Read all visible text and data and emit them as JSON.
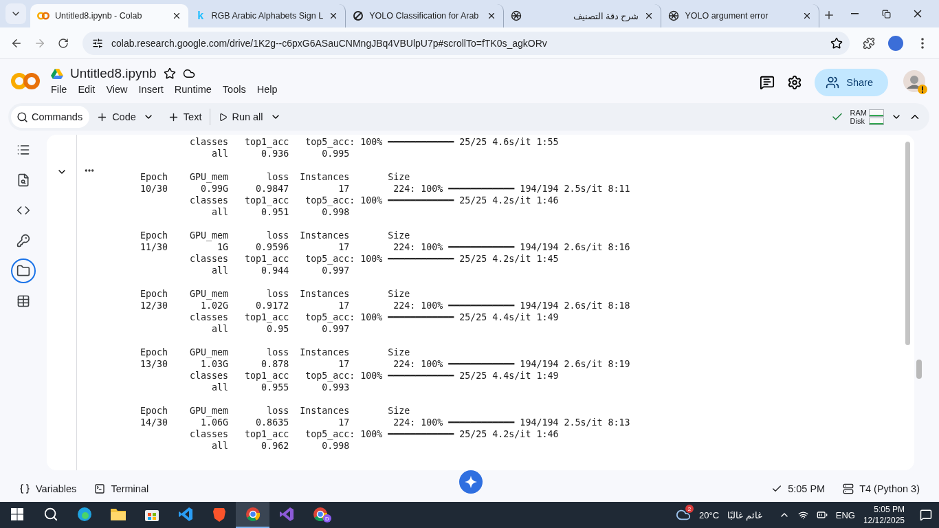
{
  "browser": {
    "tabs": [
      {
        "title": "Untitled8.ipynb - Colab",
        "kind": "colab",
        "selected": true
      },
      {
        "title": "RGB Arabic Alphabets Sign L",
        "kind": "glyph",
        "glyph": "k",
        "selected": false
      },
      {
        "title": "YOLO Classification for Arab",
        "kind": "ring",
        "selected": false
      },
      {
        "title": "شرح دقة التصنيف",
        "kind": "knot",
        "selected": false
      },
      {
        "title": "YOLO argument error",
        "kind": "knot",
        "selected": false
      }
    ],
    "url": "colab.research.google.com/drive/1K2g--c6pxG6ASauCNMngJBq4VBUlpU7p#scrollTo=fTK0s_agkORv"
  },
  "notebook": {
    "title": "Untitled8.ipynb",
    "menu": [
      "File",
      "Edit",
      "View",
      "Insert",
      "Runtime",
      "Tools",
      "Help"
    ],
    "share": "Share"
  },
  "toolbar": {
    "commands": "Commands",
    "code": "Code",
    "text": "Text",
    "run_all": "Run all",
    "connected": true,
    "ram": "RAM",
    "disk": "Disk"
  },
  "sidebar": [
    {
      "kind": "toc",
      "selected": false
    },
    {
      "kind": "find",
      "selected": false
    },
    {
      "kind": "code",
      "selected": false
    },
    {
      "kind": "key",
      "selected": false
    },
    {
      "kind": "files",
      "selected": true
    },
    {
      "kind": "table",
      "selected": false
    }
  ],
  "cell": {
    "expanded": true,
    "lines": [
      {
        "kind": "text",
        "text": "         classes   top1_acc   top5_acc: 100% ━━━━━━━━━━━━ 25/25 4.6s/it 1:55"
      },
      {
        "kind": "text",
        "text": "             all      0.936      0.995"
      },
      {
        "kind": "blank"
      },
      {
        "kind": "text",
        "text": "Epoch    GPU_mem       loss  Instances       Size"
      },
      {
        "kind": "text",
        "text": "10/30      0.99G     0.9847         17        224: 100% ━━━━━━━━━━━━ 194/194 2.5s/it 8:11"
      },
      {
        "kind": "text",
        "text": "         classes   top1_acc   top5_acc: 100% ━━━━━━━━━━━━ 25/25 4.2s/it 1:46"
      },
      {
        "kind": "text",
        "text": "             all      0.951      0.998"
      },
      {
        "kind": "blank"
      },
      {
        "kind": "text",
        "text": "Epoch    GPU_mem       loss  Instances       Size"
      },
      {
        "kind": "text",
        "text": "11/30         1G     0.9596         17        224: 100% ━━━━━━━━━━━━ 194/194 2.6s/it 8:16"
      },
      {
        "kind": "text",
        "text": "         classes   top1_acc   top5_acc: 100% ━━━━━━━━━━━━ 25/25 4.2s/it 1:45"
      },
      {
        "kind": "text",
        "text": "             all      0.944      0.997"
      },
      {
        "kind": "blank"
      },
      {
        "kind": "text",
        "text": "Epoch    GPU_mem       loss  Instances       Size"
      },
      {
        "kind": "text",
        "text": "12/30      1.02G     0.9172         17        224: 100% ━━━━━━━━━━━━ 194/194 2.6s/it 8:18"
      },
      {
        "kind": "text",
        "text": "         classes   top1_acc   top5_acc: 100% ━━━━━━━━━━━━ 25/25 4.4s/it 1:49"
      },
      {
        "kind": "text",
        "text": "             all       0.95      0.997"
      },
      {
        "kind": "blank"
      },
      {
        "kind": "text",
        "text": "Epoch    GPU_mem       loss  Instances       Size"
      },
      {
        "kind": "text",
        "text": "13/30      1.03G      0.878         17        224: 100% ━━━━━━━━━━━━ 194/194 2.6s/it 8:19"
      },
      {
        "kind": "text",
        "text": "         classes   top1_acc   top5_acc: 100% ━━━━━━━━━━━━ 25/25 4.4s/it 1:49"
      },
      {
        "kind": "text",
        "text": "             all      0.955      0.993"
      },
      {
        "kind": "blank"
      },
      {
        "kind": "text",
        "text": "Epoch    GPU_mem       loss  Instances       Size"
      },
      {
        "kind": "text",
        "text": "14/30      1.06G     0.8635         17        224: 100% ━━━━━━━━━━━━ 194/194 2.5s/it 8:13"
      },
      {
        "kind": "text",
        "text": "         classes   top1_acc   top5_acc: 100% ━━━━━━━━━━━━ 25/25 4.2s/it 1:46"
      },
      {
        "kind": "text",
        "text": "             all      0.962      0.998"
      }
    ]
  },
  "status": {
    "variables": "Variables",
    "terminal": "Terminal",
    "time": "5:05 PM",
    "runtime": "T4 (Python 3)"
  },
  "taskbar": {
    "apps": [
      {
        "kind": "edge",
        "selected": false
      },
      {
        "kind": "explorer",
        "selected": false
      },
      {
        "kind": "store",
        "selected": false
      },
      {
        "kind": "vscode",
        "selected": false
      },
      {
        "kind": "brave",
        "selected": false
      },
      {
        "kind": "chrome",
        "selected": true
      },
      {
        "kind": "vs",
        "selected": false
      },
      {
        "kind": "chrome",
        "badge": "D",
        "selected": false
      }
    ],
    "weather_badge": "2",
    "temp": "20°C",
    "weather": "غائم غالبًا",
    "lang": "ENG",
    "time": "5:05 PM",
    "date": "12/12/2025"
  }
}
